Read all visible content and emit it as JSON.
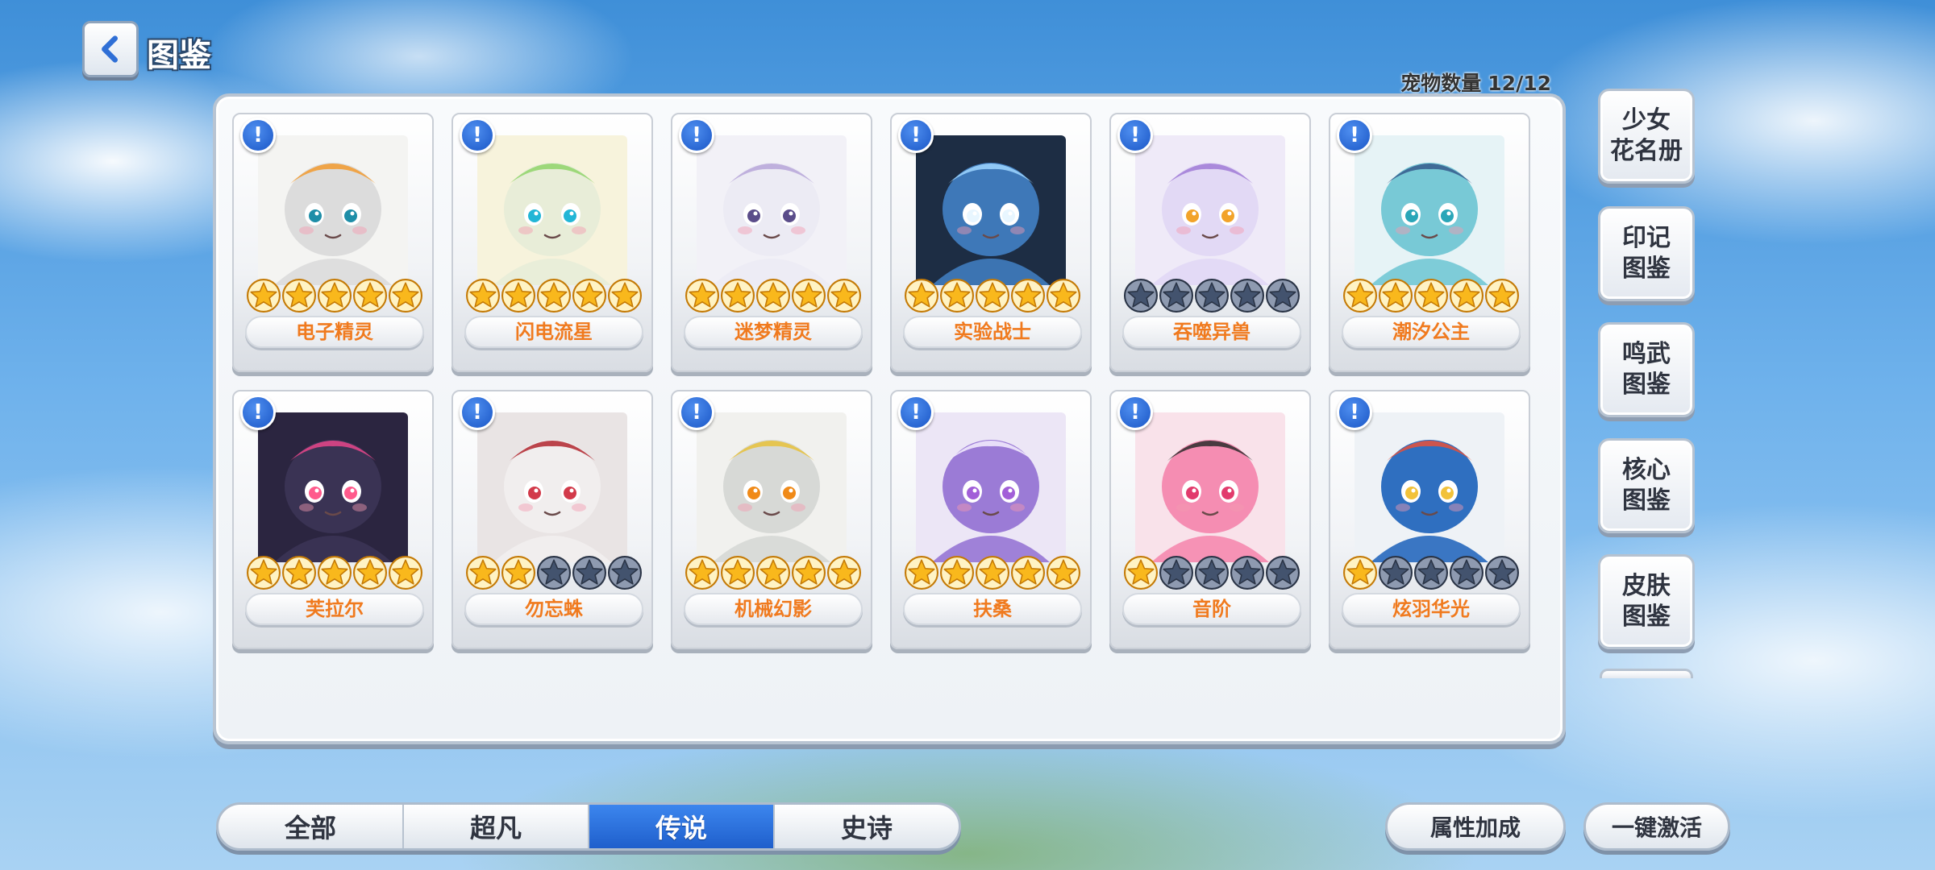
{
  "header": {
    "title": "图鉴",
    "pet_count_label": "宠物数量",
    "pet_count_value": "12/12"
  },
  "pets": [
    {
      "name": "电子精灵",
      "stars": 5,
      "theme": "robot-white"
    },
    {
      "name": "闪电流星",
      "stars": 5,
      "theme": "electric-green"
    },
    {
      "name": "迷梦精灵",
      "stars": 5,
      "theme": "dream-white"
    },
    {
      "name": "实验战士",
      "stars": 5,
      "theme": "dark-blue"
    },
    {
      "name": "吞噬异兽",
      "stars": 0,
      "theme": "lavender-beast"
    },
    {
      "name": "潮汐公主",
      "stars": 5,
      "theme": "tide-teal"
    },
    {
      "name": "芙拉尔",
      "stars": 5,
      "theme": "dark-fairy"
    },
    {
      "name": "勿忘蛛",
      "stars": 2,
      "theme": "white-spider"
    },
    {
      "name": "机械幻影",
      "stars": 5,
      "theme": "mecha-gold"
    },
    {
      "name": "扶桑",
      "stars": 5,
      "theme": "purple-oni"
    },
    {
      "name": "音阶",
      "stars": 1,
      "theme": "pink-music"
    },
    {
      "name": "炫羽华光",
      "stars": 1,
      "theme": "peacock"
    }
  ],
  "side_menu": [
    {
      "label": "少女\n花名册"
    },
    {
      "label": "印记\n图鉴"
    },
    {
      "label": "鸣武\n图鉴"
    },
    {
      "label": "核心\n图鉴"
    },
    {
      "label": "皮肤\n图鉴"
    }
  ],
  "tabs": [
    {
      "label": "全部",
      "active": false
    },
    {
      "label": "超凡",
      "active": false
    },
    {
      "label": "传说",
      "active": true
    },
    {
      "label": "史诗",
      "active": false
    }
  ],
  "actions": {
    "attribute_bonus": "属性加成",
    "activate_all": "一键激活"
  },
  "colors": {
    "star_filled": "#f9b81c",
    "star_empty": "#43536e",
    "pet_name": "#f07a1e",
    "tab_active": "#2a6fdc",
    "info_badge": "#1a56c6"
  },
  "icons": {
    "back": "chevron-left-icon",
    "info": "exclamation-icon",
    "star": "star-icon"
  }
}
